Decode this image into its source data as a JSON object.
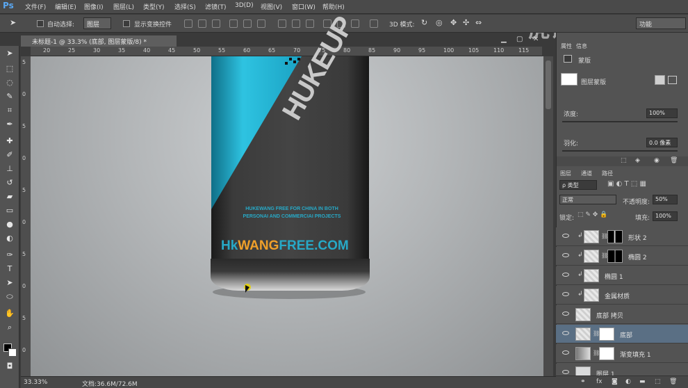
{
  "app": {
    "logo": "Ps"
  },
  "menus": [
    "文件(F)",
    "编辑(E)",
    "图像(I)",
    "图层(L)",
    "类型(Y)",
    "选择(S)",
    "滤镜(T)",
    "3D(D)",
    "视图(V)",
    "窗口(W)",
    "帮助(H)"
  ],
  "options": {
    "auto_select_label": "自动选择:",
    "auto_select_value": "图层",
    "show_transform_label": "显示变换控件",
    "mode_3d_label": "3D 模式:",
    "workspace": "功能"
  },
  "watermark": "虎课网",
  "document": {
    "tab_title": "未标题-1 @ 33.3% (底部, 图层蒙版/8) *",
    "zoom": "33.33%",
    "doc_info": "文档:36.6M/72.6M"
  },
  "ruler": {
    "top": [
      "20",
      "25",
      "30",
      "35",
      "40",
      "45",
      "50",
      "55",
      "60",
      "65",
      "70",
      "75",
      "80",
      "85",
      "90",
      "95",
      "100",
      "105",
      "110",
      "115"
    ],
    "left": [
      "5",
      "0",
      "5",
      "0",
      "5",
      "0",
      "5",
      "0",
      "5",
      "0"
    ]
  },
  "can": {
    "brand": "HUKEUP",
    "tagline1": "HUKEWANG FREE FOR CHINA IN BOTH",
    "tagline2": "PERSONAI AND COMMERCIAI PROJECTS",
    "url_part1": "Hk",
    "url_part2": "WANG",
    "url_part3": "FREE",
    "url_part4": ".COM"
  },
  "properties": {
    "tabs": [
      "属性",
      "信息"
    ],
    "mask_label": "蒙版",
    "layer_mask_label": "图层蒙版",
    "density_label": "浓度:",
    "density_value": "100%",
    "feather_label": "羽化:",
    "feather_value": "0.0 像素"
  },
  "layers_panel": {
    "tabs": [
      "图层",
      "通道",
      "路径"
    ],
    "kind_filter": "ρ 类型",
    "blend_mode": "正常",
    "opacity_label": "不透明度:",
    "opacity_value": "50%",
    "lock_label": "锁定:",
    "fill_label": "填充:",
    "fill_value": "100%",
    "layers": [
      {
        "name": "形状 2",
        "clip": true,
        "mask": "dark"
      },
      {
        "name": "椭圆 2",
        "clip": true,
        "mask": "dark2"
      },
      {
        "name": "椭圆 1",
        "clip": true,
        "mask": "none"
      },
      {
        "name": "金属材质",
        "clip": true,
        "mask": "none"
      },
      {
        "name": "底部 拷贝",
        "clip": false,
        "mask": "none"
      },
      {
        "name": "底部",
        "clip": false,
        "mask": "white"
      },
      {
        "name": "渐变填充 1",
        "clip": false,
        "mask": "white"
      },
      {
        "name": "图层 1",
        "clip": false,
        "mask": "none"
      }
    ]
  },
  "colors": {
    "accent": "#27a9c7",
    "brand_orange": "#f0a02a",
    "selected": "#5a6f84"
  }
}
